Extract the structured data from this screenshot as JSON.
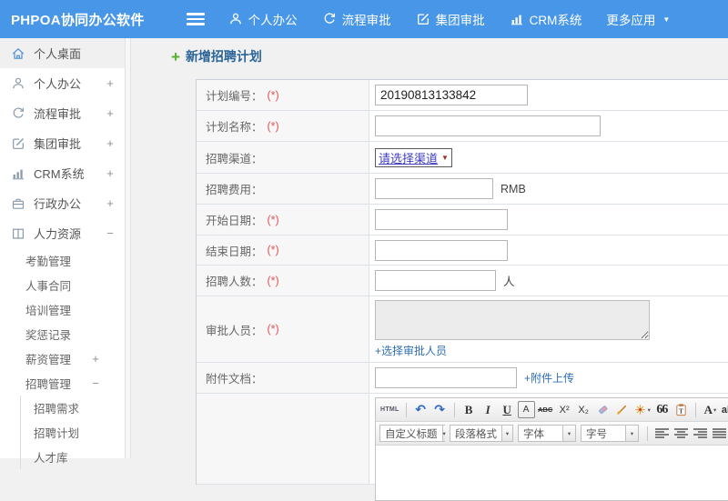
{
  "topbar": {
    "brand": "PHPOA协同办公软件",
    "nav": [
      {
        "label": "个人办公",
        "icon": "user-icon"
      },
      {
        "label": "流程审批",
        "icon": "flow-icon"
      },
      {
        "label": "集团审批",
        "icon": "edit-icon"
      },
      {
        "label": "CRM系统",
        "icon": "chart-icon"
      },
      {
        "label": "更多应用",
        "icon": "caret-down-icon"
      }
    ]
  },
  "sidebar": {
    "items": [
      {
        "label": "个人桌面",
        "expand": ""
      },
      {
        "label": "个人办公",
        "expand": "+"
      },
      {
        "label": "流程审批",
        "expand": "+"
      },
      {
        "label": "集团审批",
        "expand": "+"
      },
      {
        "label": "CRM系统",
        "expand": "+"
      },
      {
        "label": "行政办公",
        "expand": "+"
      },
      {
        "label": "人力资源",
        "expand": "−"
      },
      {
        "label": "考勤管理",
        "expand": ""
      },
      {
        "label": "人事合同",
        "expand": ""
      },
      {
        "label": "培训管理",
        "expand": ""
      },
      {
        "label": "奖惩记录",
        "expand": ""
      },
      {
        "label": "薪资管理",
        "expand": "+"
      },
      {
        "label": "招聘管理",
        "expand": "−"
      },
      {
        "label": "招聘需求",
        "expand": ""
      },
      {
        "label": "招聘计划",
        "expand": ""
      },
      {
        "label": "人才库",
        "expand": ""
      }
    ]
  },
  "page": {
    "title": "新增招聘计划"
  },
  "form": {
    "rows": [
      {
        "label": "计划编号：",
        "required": "(*)",
        "value": "20190813133842"
      },
      {
        "label": "计划名称：",
        "required": "(*)",
        "value": ""
      },
      {
        "label": "招聘渠道：",
        "select_value": "请选择渠道"
      },
      {
        "label": "招聘费用：",
        "suffix": "RMB"
      },
      {
        "label": "开始日期：",
        "required": "(*)"
      },
      {
        "label": "结束日期：",
        "required": "(*)"
      },
      {
        "label": "招聘人数：",
        "required": "(*)",
        "suffix": "人"
      },
      {
        "label": "审批人员：",
        "required": "(*)",
        "link": "+选择审批人员"
      },
      {
        "label": "附件文档：",
        "link": "+附件上传"
      }
    ]
  },
  "editor": {
    "tb1": {
      "html": "HTML",
      "undo": "↶",
      "redo": "↷",
      "bold": "B",
      "italic": "I",
      "underline": "U",
      "charstyle": "A",
      "strike": "ABC",
      "sup": "X²",
      "sub": "X₂",
      "quote": "66",
      "fontcolor": "A",
      "highlight": "ab"
    },
    "selects": [
      {
        "label": "自定义标题"
      },
      {
        "label": "段落格式"
      },
      {
        "label": "字体"
      },
      {
        "label": "字号"
      }
    ]
  },
  "icons": {
    "plus": "+",
    "caret_down": "▼",
    "caret_small": "▾"
  },
  "colors": {
    "topbar_blue": "#4796e8",
    "title_blue": "#2a6496",
    "link_blue": "#2e6db4",
    "required_red": "#e05656",
    "plus_green": "#55b030"
  }
}
